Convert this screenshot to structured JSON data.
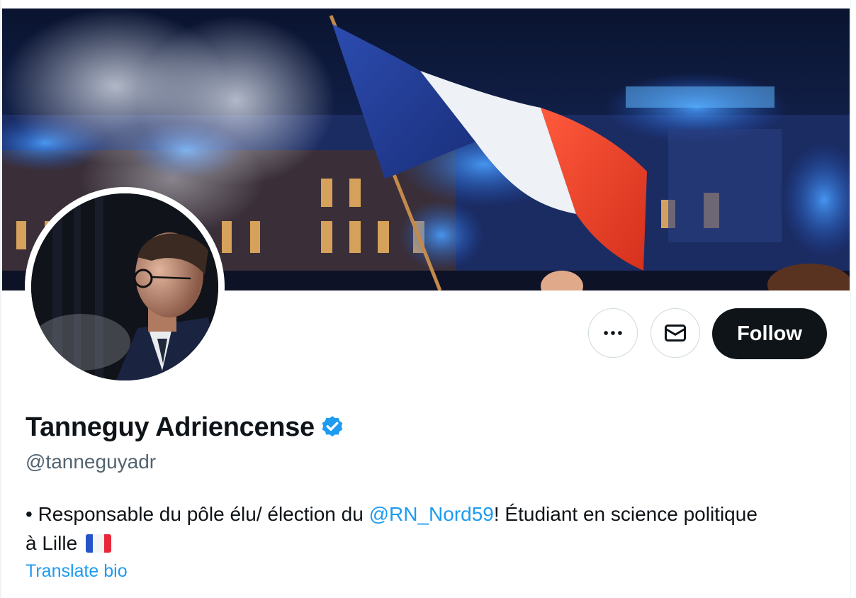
{
  "profile": {
    "display_name": "Tanneguy Adriencense",
    "handle": "@tanneguyadr",
    "verified": true,
    "bio": {
      "prefix": "• Responsable du pôle élu/ élection du ",
      "mention": "@RN_Nord59",
      "middle": "! Étudiant en science politique",
      "suffix": "à Lille ",
      "flag_emoji_icon": "france-flag-icon"
    },
    "translate_bio_label": "Translate bio"
  },
  "actions": {
    "more_icon": "more-horizontal-icon",
    "message_icon": "envelope-icon",
    "follow_label": "Follow"
  },
  "images": {
    "banner": "banner-image: french flag waved over illuminated city square at night",
    "avatar": "avatar-photo: man with glasses in profile, dark background"
  },
  "colors": {
    "accent": "#1d9bf0",
    "text_primary": "#0f1419",
    "text_secondary": "#536471",
    "follow_bg": "#0f1419",
    "border": "#cfd9de"
  }
}
